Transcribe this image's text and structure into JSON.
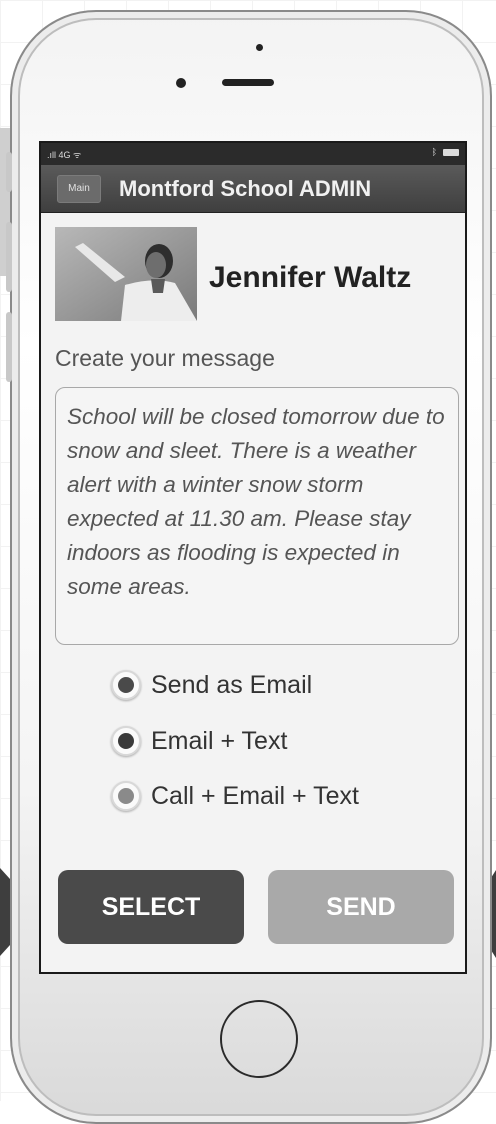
{
  "status_bar": {
    "carrier": ".ıll 4G ᯤ"
  },
  "header": {
    "main_button": "Main",
    "title": "Montford School ADMIN"
  },
  "profile": {
    "name": "Jennifer Waltz"
  },
  "compose": {
    "label": "Create your message",
    "message": "School will be closed tomorrow due to snow and sleet. There is a weather alert with a winter snow storm expected at 11.30 am. Please stay indoors as flooding is expected in some areas."
  },
  "options": [
    {
      "label": "Send as Email",
      "dot_color": "#4a4a4a"
    },
    {
      "label": "Email + Text",
      "dot_color": "#3a3a3a"
    },
    {
      "label": "Call + Email + Text",
      "dot_color": "#8a8a8a"
    }
  ],
  "actions": {
    "select_label": "SELECT",
    "send_label": "SEND"
  },
  "colors": {
    "select_bg": "#4a4a4a",
    "send_bg": "#a9a9a9",
    "nav_bg": "#3f3f3f"
  }
}
